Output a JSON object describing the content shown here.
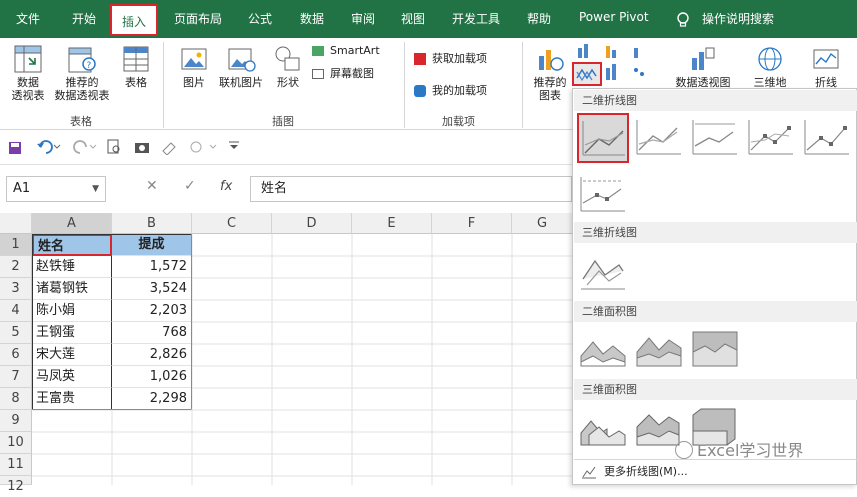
{
  "menu": {
    "items": [
      "文件",
      "开始",
      "插入",
      "页面布局",
      "公式",
      "数据",
      "审阅",
      "视图",
      "开发工具",
      "帮助",
      "Power Pivot",
      "操作说明搜索"
    ]
  },
  "ribbon": {
    "pivot": "数据\n透视表",
    "recommended_pivot": "推荐的\n数据透视表",
    "table": "表格",
    "group_table": "表格",
    "pictures": "图片",
    "online_pictures": "联机图片",
    "shapes": "形状",
    "smartart": "SmartArt",
    "screenshot": "屏幕截图",
    "group_illustrations": "插图",
    "get_addins": "获取加载项",
    "my_addins": "我的加载项",
    "group_addins": "加载项",
    "recommended_charts": "推荐的\n图表",
    "pivot_chart": "数据透视图",
    "map_3d": "三维地",
    "sparkline": "折线"
  },
  "formula_bar": {
    "name_box": "A1",
    "fx": "fx",
    "content": "姓名"
  },
  "sheet": {
    "columns": [
      "A",
      "B",
      "C",
      "D",
      "E",
      "F",
      "G"
    ],
    "rows": [
      "1",
      "2",
      "3",
      "4",
      "5",
      "6",
      "7",
      "8",
      "9",
      "10",
      "11",
      "12"
    ],
    "header": [
      "姓名",
      "提成"
    ],
    "data": [
      [
        "赵铁锤",
        "1,572"
      ],
      [
        "诸葛钢铁",
        "3,524"
      ],
      [
        "陈小娟",
        "2,203"
      ],
      [
        "王钢蛋",
        "768"
      ],
      [
        "宋大莲",
        "2,826"
      ],
      [
        "马凤英",
        "1,026"
      ],
      [
        "王富贵",
        "2,298"
      ]
    ]
  },
  "chart_menu": {
    "sections": [
      "二维折线图",
      "三维折线图",
      "二维面积图",
      "三维面积图"
    ],
    "more": "更多折线图(M)...",
    "watermark": "Excel学习世界"
  },
  "colors": {
    "accent": "#217346",
    "highlight": "#d9262c"
  }
}
